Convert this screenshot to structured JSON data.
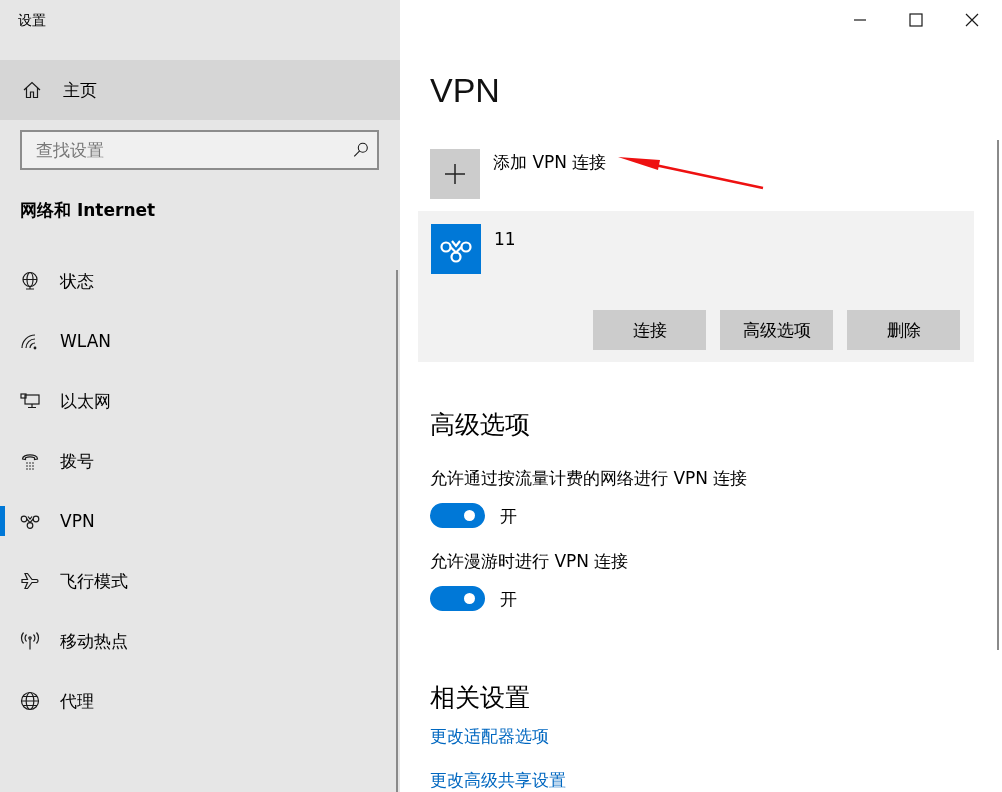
{
  "window": {
    "title": "设置"
  },
  "sidebar": {
    "home": {
      "label": "主页",
      "highlighted": true
    },
    "search": {
      "placeholder": "查找设置"
    },
    "category": "网络和 Internet",
    "items": [
      {
        "label": "状态",
        "selected": false
      },
      {
        "label": "WLAN",
        "selected": false
      },
      {
        "label": "以太网",
        "selected": false
      },
      {
        "label": "拨号",
        "selected": false
      },
      {
        "label": "VPN",
        "selected": true
      },
      {
        "label": "飞行模式",
        "selected": false
      },
      {
        "label": "移动热点",
        "selected": false
      },
      {
        "label": "代理",
        "selected": false
      }
    ]
  },
  "page": {
    "title": "VPN",
    "add_connection": {
      "label": "添加 VPN 连接"
    },
    "connections": [
      {
        "name": "11",
        "selected": true,
        "buttons": [
          "连接",
          "高级选项",
          "删除"
        ]
      }
    ],
    "advanced": {
      "heading": "高级选项",
      "options": [
        {
          "label": "允许通过按流量计费的网络进行 VPN 连接",
          "on": true,
          "state_text": "开"
        },
        {
          "label": "允许漫游时进行 VPN 连接",
          "on": true,
          "state_text": "开"
        }
      ]
    },
    "related": {
      "heading": "相关设置",
      "links": [
        "更改适配器选项",
        "更改高级共享设置"
      ]
    }
  }
}
